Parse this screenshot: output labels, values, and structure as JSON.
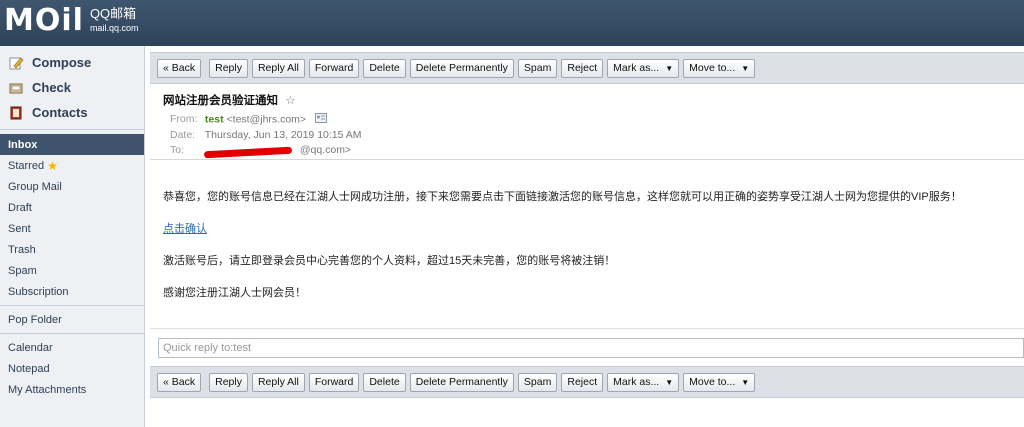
{
  "logo": {
    "word": "MOil",
    "qq": "QQ邮箱",
    "url": "mail.qq.com"
  },
  "sidebar": {
    "compose": "Compose",
    "check": "Check",
    "contacts": "Contacts",
    "items": [
      {
        "label": "Inbox",
        "active": true
      },
      {
        "label": "Starred"
      },
      {
        "label": "Group Mail"
      },
      {
        "label": "Draft"
      },
      {
        "label": "Sent"
      },
      {
        "label": "Trash"
      },
      {
        "label": "Spam"
      },
      {
        "label": "Subscription"
      }
    ],
    "pop_folder": "Pop Folder",
    "tools": [
      {
        "label": "Calendar"
      },
      {
        "label": "Notepad"
      },
      {
        "label": "My Attachments"
      }
    ]
  },
  "toolbar": {
    "back": "« Back",
    "reply": "Reply",
    "reply_all": "Reply All",
    "forward": "Forward",
    "delete": "Delete",
    "delete_permanently": "Delete Permanently",
    "spam": "Spam",
    "reject": "Reject",
    "mark_as": "Mark as...",
    "move_to": "Move to..."
  },
  "email": {
    "subject": "网站注册会员验证通知",
    "from_label": "From:",
    "from_name": "test",
    "from_addr": "<test@jhrs.com>",
    "date_label": "Date:",
    "date": "Thursday, Jun 13, 2019 10:15 AM",
    "to_label": "To:",
    "to_addr": "@qq.com>",
    "body": [
      "恭喜您，您的账号信息已经在江湖人士网成功注册，接下来您需要点击下面链接激活您的账号信息，这样您就可以用正确的姿势享受江湖人士网为您提供的VIP服务！",
      "点击确认",
      "激活账号后，请立即登录会员中心完善您的个人资料，超过15天未完善，您的账号将被注销！",
      "感谢您注册江湖人士网会员！"
    ]
  },
  "quick_reply": {
    "placeholder": "Quick reply to:test"
  }
}
